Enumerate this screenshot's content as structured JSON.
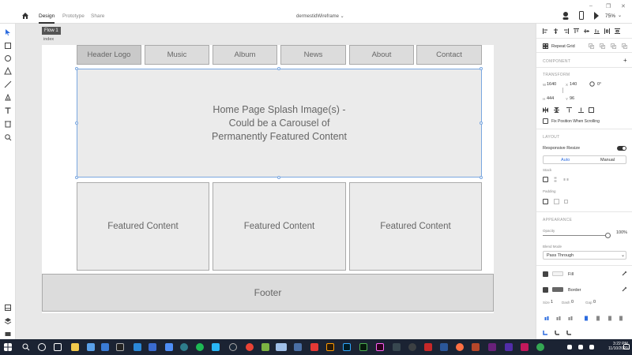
{
  "header": {
    "tabs": [
      {
        "label": "Design"
      },
      {
        "label": "Prototype"
      },
      {
        "label": "Share"
      }
    ],
    "document_title": "dermestidWireframe",
    "zoom": "75%"
  },
  "canvas": {
    "flow_label": "Flow 1",
    "artboard_name": "index",
    "nav_items": [
      {
        "label": "Header Logo"
      },
      {
        "label": "Music"
      },
      {
        "label": "Album"
      },
      {
        "label": "News"
      },
      {
        "label": "About"
      },
      {
        "label": "Contact"
      }
    ],
    "splash_text": "Home Page Splash Image(s) -\nCould be a Carousel of\nPermanently Featured Content",
    "featured": [
      {
        "label": "Featured Content"
      },
      {
        "label": "Featured Content"
      },
      {
        "label": "Featured Content"
      }
    ],
    "footer_label": "Footer"
  },
  "panel": {
    "repeat_grid": "Repeat Grid",
    "component_section": "COMPONENT",
    "transform_section": "TRANSFORM",
    "w_label": "W",
    "w_value": "1640",
    "x_label": "X",
    "x_value": "140",
    "rotation": "0°",
    "h_label": "H",
    "h_value": "444",
    "y_label": "Y",
    "y_value": "96",
    "fix_position": "Fix Position When Scrolling",
    "layout_section": "LAYOUT",
    "responsive_resize": "Responsive Resize",
    "auto": "Auto",
    "manual": "Manual",
    "stack": "Stack",
    "padding": "Padding",
    "appearance_section": "APPEARANCE",
    "opacity_label": "Opacity",
    "opacity_value": "100%",
    "blend_label": "Blend Mode",
    "blend_value": "Pass Through",
    "fill_label": "Fill",
    "border_label": "Border",
    "size_label": "Size",
    "size_value": "1",
    "dash_label": "Dash",
    "dash_value": "0",
    "gap_label": "Gap",
    "gap_value": "0"
  },
  "taskbar": {
    "time": "3:22 PM",
    "date": "11/10/2020"
  },
  "colors": {
    "selection": "#7aa7e0",
    "taskbar": "#1b2333"
  }
}
